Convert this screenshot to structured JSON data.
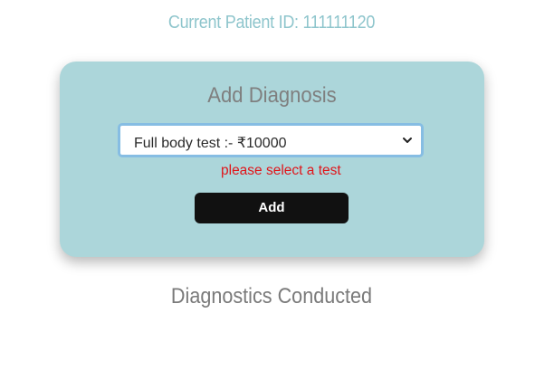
{
  "header": {
    "patient_id_text": "Current Patient ID: 111111120"
  },
  "card": {
    "title": "Add Diagnosis",
    "select": {
      "selected_value": "Full body test :- ₹10000"
    },
    "error_text": "please select a test",
    "add_button_label": "Add"
  },
  "section": {
    "title": "Diagnostics Conducted"
  },
  "colors": {
    "patient_id": "#8ec5cc",
    "card_bg": "#acd6da",
    "error": "#e0161b",
    "button_bg": "#111111",
    "select_border": "#86bde3"
  },
  "icons": {
    "select_arrow": "chevron-down-icon"
  }
}
